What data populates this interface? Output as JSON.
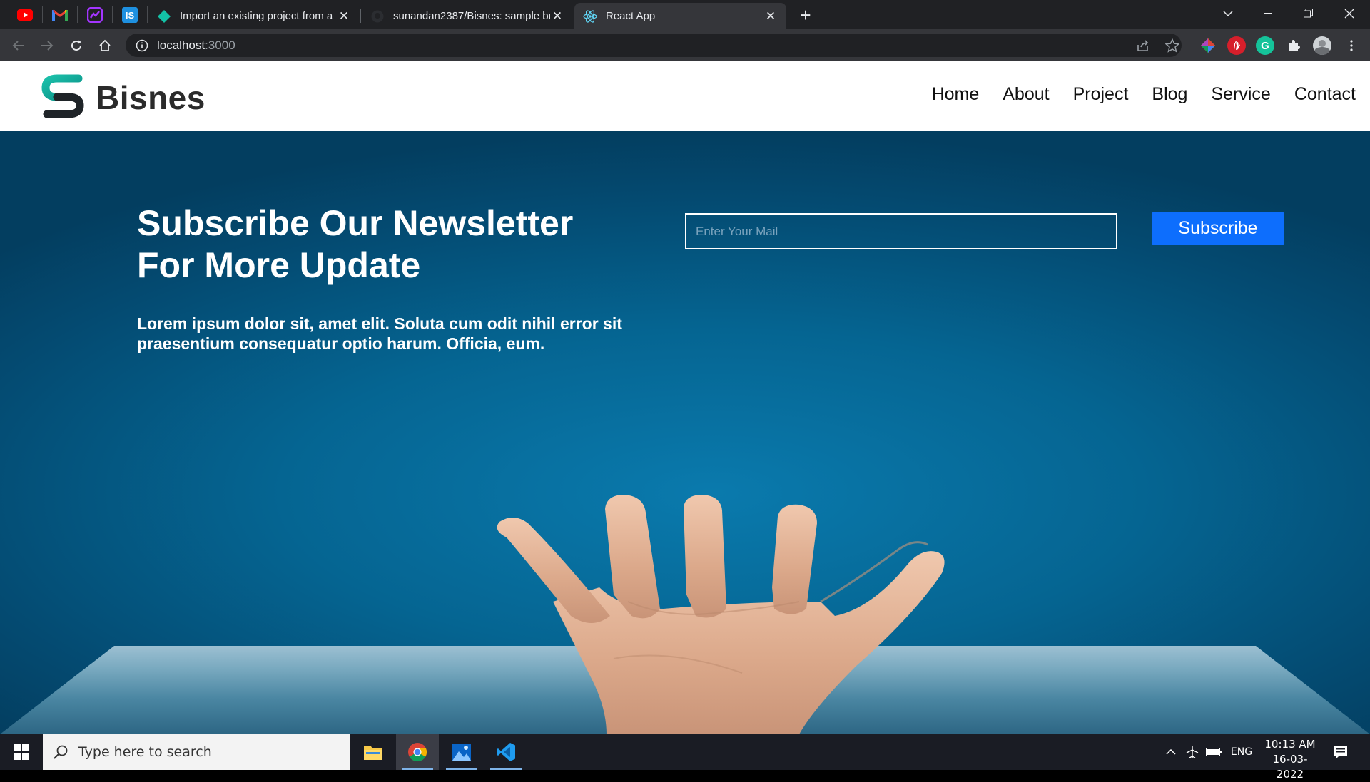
{
  "browser": {
    "tabs": [
      {
        "title": "Import an existing project from a",
        "icon": "diamond-icon",
        "active": false
      },
      {
        "title": "sunandan2387/Bisnes: sample bu",
        "icon": "github-icon",
        "active": false
      },
      {
        "title": "React App",
        "icon": "react-icon",
        "active": true
      }
    ],
    "pinned_tabs": [
      "youtube-icon",
      "gmail-icon",
      "messenger-icon",
      "is-icon"
    ],
    "url_host": "localhost",
    "url_port": ":3000",
    "extensions": [
      "colorful-extension-icon",
      "adblock-icon",
      "grammarly-icon",
      "puzzle-icon",
      "profile-avatar"
    ]
  },
  "navbar": {
    "brand": "Bisnes",
    "menu": [
      "Home",
      "About",
      "Project",
      "Blog",
      "Service",
      "Contact"
    ]
  },
  "hero": {
    "title_line1": "Subscribe Our Newsletter",
    "title_line2": "For More Update",
    "text": "Lorem ipsum dolor sit, amet elit. Soluta cum odit nihil error sit praesentium consequatur optio harum. Officia, eum.",
    "input_placeholder": "Enter Your Mail",
    "button_label": "Subscribe"
  },
  "taskbar": {
    "search_placeholder": "Type here to search",
    "apps": [
      "file-explorer-icon",
      "chrome-icon",
      "photos-icon",
      "vscode-icon"
    ],
    "language": "ENG",
    "time": "10:13 AM",
    "date": "16-03-2022"
  },
  "colors": {
    "subscribe_button": "#0d6efd",
    "hero_blue": "#056592",
    "browser_dark": "#202124"
  }
}
